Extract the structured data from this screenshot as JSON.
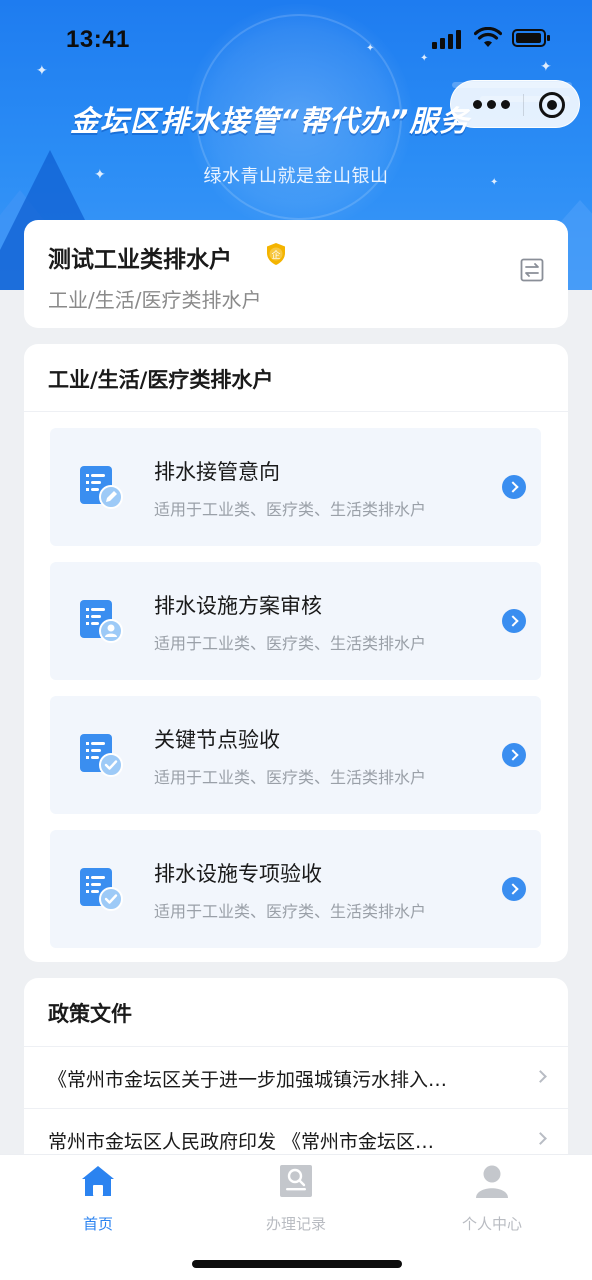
{
  "status_bar": {
    "time": "13:41"
  },
  "banner": {
    "title": "金坛区排水接管“帮代办”服务",
    "subtitle": "绿水青山就是金山银山"
  },
  "account": {
    "name": "测试工业类排水户",
    "badge": "企",
    "type": "工业/生活/医疗类排水户"
  },
  "service_section": {
    "title": "工业/生活/医疗类排水户",
    "items": [
      {
        "title": "排水接管意向",
        "desc": "适用于工业类、医疗类、生活类排水户",
        "icon": "document-edit-icon"
      },
      {
        "title": "排水设施方案审核",
        "desc": "适用于工业类、医疗类、生活类排水户",
        "icon": "document-user-icon"
      },
      {
        "title": "关键节点验收",
        "desc": "适用于工业类、医疗类、生活类排水户",
        "icon": "document-check-icon"
      },
      {
        "title": "排水设施专项验收",
        "desc": "适用于工业类、医疗类、生活类排水户",
        "icon": "document-check-icon"
      }
    ]
  },
  "policy_section": {
    "title": "政策文件",
    "items": [
      {
        "text": "《常州市金坛区关于进一步加强城镇污水排入…"
      },
      {
        "text": "常州市金坛区人民政府印发 《常州市金坛区…"
      }
    ]
  },
  "tabbar": {
    "items": [
      {
        "label": "首页",
        "icon": "home-icon",
        "active": true
      },
      {
        "label": "办理记录",
        "icon": "records-icon",
        "active": false
      },
      {
        "label": "个人中心",
        "icon": "user-icon",
        "active": false
      }
    ]
  },
  "colors": {
    "primary": "#2b83f0",
    "banner": "#1e7cf0",
    "item_background": "#f2f6fc",
    "badge_gold": "#f4b400"
  }
}
